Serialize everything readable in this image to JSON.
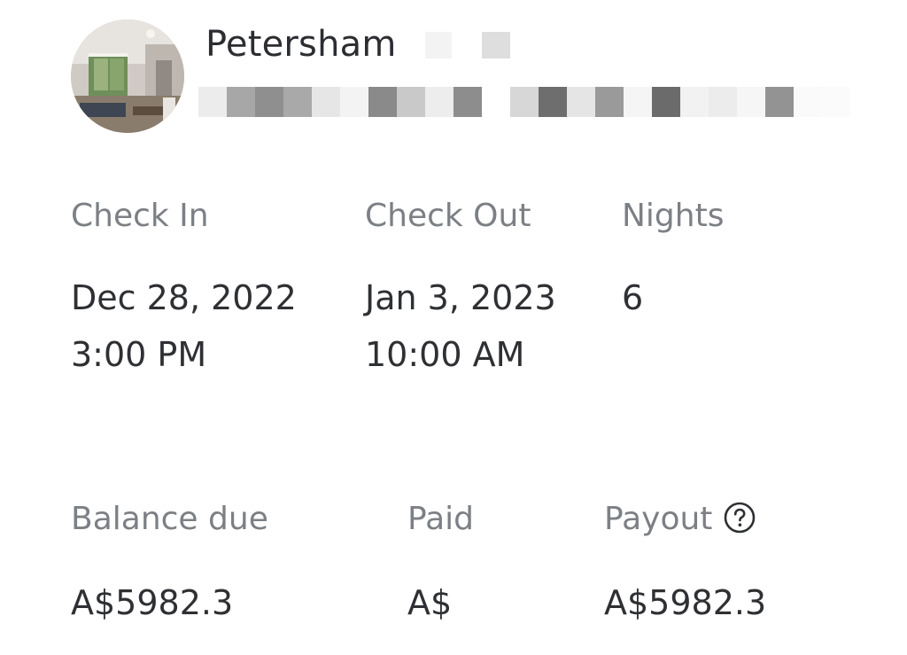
{
  "header": {
    "property_name": "Petersham",
    "avatar_icon": "property-photo"
  },
  "stay": {
    "check_in": {
      "label": "Check In",
      "date": "Dec 28, 2022",
      "time": "3:00 PM"
    },
    "check_out": {
      "label": "Check Out",
      "date": "Jan 3, 2023",
      "time": "10:00 AM"
    },
    "nights": {
      "label": "Nights",
      "value": "6"
    }
  },
  "payment": {
    "balance_due": {
      "label": "Balance due",
      "value": "A$5982.3"
    },
    "paid": {
      "label": "Paid",
      "value": "A$"
    },
    "payout": {
      "label": "Payout",
      "value": "A$5982.3",
      "info_icon": "help-circle-icon"
    }
  },
  "colors": {
    "label_gray": "#7c8085",
    "value_dark": "#2e3033",
    "background": "#ffffff"
  }
}
